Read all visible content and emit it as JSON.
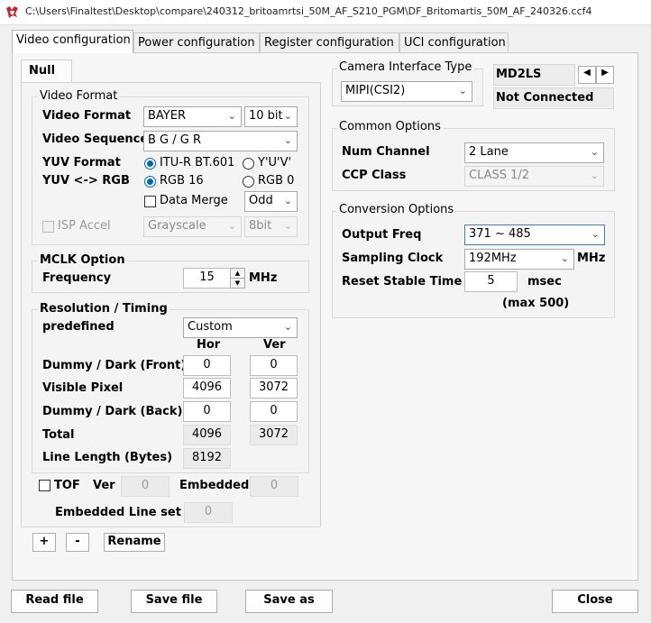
{
  "window": {
    "title": "C:\\Users\\Finaltest\\Desktop\\compare\\240312_britoamrtsi_50M_AF_S210_PGM\\DF_Britomartis_50M_AF_240326.ccf4"
  },
  "tabs": [
    "Video configuration",
    "Power configuration",
    "Register configuration",
    "UCI configuration"
  ],
  "subtab": "Null",
  "video_format": {
    "group_label": "Video Format",
    "format_label": "Video Format",
    "format_value": "BAYER",
    "bits_value": "10 bit",
    "sequence_label": "Video Sequence",
    "sequence_value": "B G / G R",
    "yuv_format_label": "YUV Format",
    "yuv_opt1": "ITU-R BT.601",
    "yuv_opt2": "Y'U'V'",
    "yuv_rgb_label": "YUV <-> RGB",
    "rgb_opt1": "RGB 16",
    "rgb_opt2": "RGB 0",
    "data_merge_label": "Data Merge",
    "merge_value": "Odd",
    "isp_accel_label": "ISP Accel",
    "isp_mode": "Grayscale",
    "isp_bits": "8bit"
  },
  "mclk": {
    "group_label": "MCLK Option",
    "freq_label": "Frequency",
    "freq_value": "15",
    "unit": "MHz"
  },
  "resolution": {
    "group_label": "Resolution / Timing",
    "predefined_label": "predefined",
    "predefined_value": "Custom",
    "hor_header": "Hor",
    "ver_header": "Ver",
    "rows": [
      {
        "label": "Dummy / Dark (Front)",
        "hor": "0",
        "ver": "0"
      },
      {
        "label": "Visible Pixel",
        "hor": "4096",
        "ver": "3072"
      },
      {
        "label": "Dummy / Dark (Back)",
        "hor": "0",
        "ver": "0"
      }
    ],
    "total_label": "Total",
    "total_hor": "4096",
    "total_ver": "3072",
    "line_length_label": "Line Length (Bytes)",
    "line_length_value": "8192"
  },
  "tof": {
    "tof_label": "TOF",
    "ver_label": "Ver",
    "ver_value": "0",
    "embedded_label": "Embedded",
    "embedded_value": "0",
    "embedded_line_label": "Embedded Line set",
    "embedded_line_value": "0"
  },
  "list_buttons": {
    "add": "+",
    "remove": "-",
    "rename": "Rename"
  },
  "camera": {
    "group_label": "Camera Interface Type",
    "interface_value": "MIPI(CSI2)",
    "device": "MD2LS",
    "status": "Not Connected"
  },
  "common": {
    "group_label": "Common Options",
    "channel_label": "Num Channel",
    "channel_value": "2 Lane",
    "ccp_label": "CCP Class",
    "ccp_value": "CLASS 1/2"
  },
  "conversion": {
    "group_label": "Conversion Options",
    "freq_label": "Output Freq",
    "freq_value": "371 ~ 485",
    "clock_label": "Sampling Clock",
    "clock_value": "192MHz",
    "clock_unit": "MHz",
    "reset_label": "Reset Stable Time",
    "reset_value": "5",
    "reset_unit": "msec",
    "reset_max": "(max 500)"
  },
  "footer": {
    "read": "Read file",
    "save": "Save file",
    "save_as": "Save as",
    "close": "Close"
  },
  "accent_color": "#0067c0"
}
